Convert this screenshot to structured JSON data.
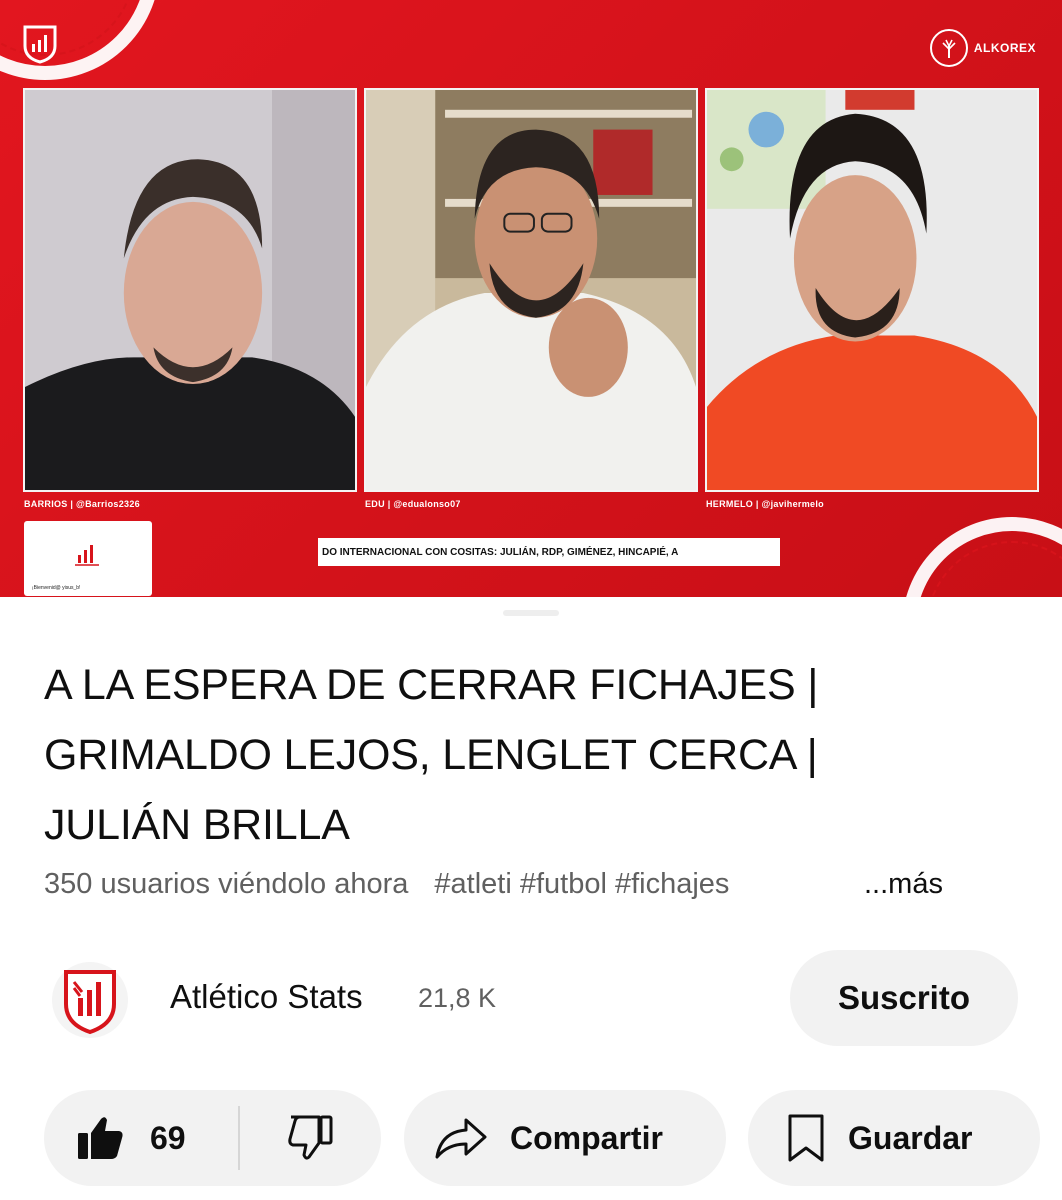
{
  "player": {
    "sponsor_name": "ALKOREX",
    "cams": [
      {
        "label": "BARRIOS | @Barrios2326"
      },
      {
        "label": "EDU | @edualonso07"
      },
      {
        "label": "HERMELO | @javihermelo"
      }
    ],
    "welcome_text": "¡Bienvenid@ yisus_b!",
    "ticker": "DO INTERNACIONAL CON COSITAS: JULIÁN, RDP, GIMÉNEZ, HINCAPIÉ, A"
  },
  "video": {
    "title_line1": "A LA ESPERA DE CERRAR FICHAJES |",
    "title_line2": "GRIMALDO LEJOS, LENGLET CERCA |",
    "title_line3": "JULIÁN BRILLA",
    "views": "350 usuarios viéndolo ahora",
    "tags": "#atleti #futbol #fichajes",
    "more": "...más"
  },
  "channel": {
    "name": "Atlético Stats",
    "subscribers": "21,8 K",
    "subscribe_label": "Suscrito"
  },
  "actions": {
    "likes": "69",
    "share_label": "Compartir",
    "save_label": "Guardar"
  },
  "icons": {
    "like": "thumbs-up-filled-icon",
    "dislike": "thumbs-down-outline-icon",
    "share": "share-arrow-icon",
    "save": "bookmark-icon"
  },
  "colors": {
    "brand_red": "#d7141b",
    "pill_bg": "#f2f2f2",
    "secondary_text": "#606060"
  }
}
